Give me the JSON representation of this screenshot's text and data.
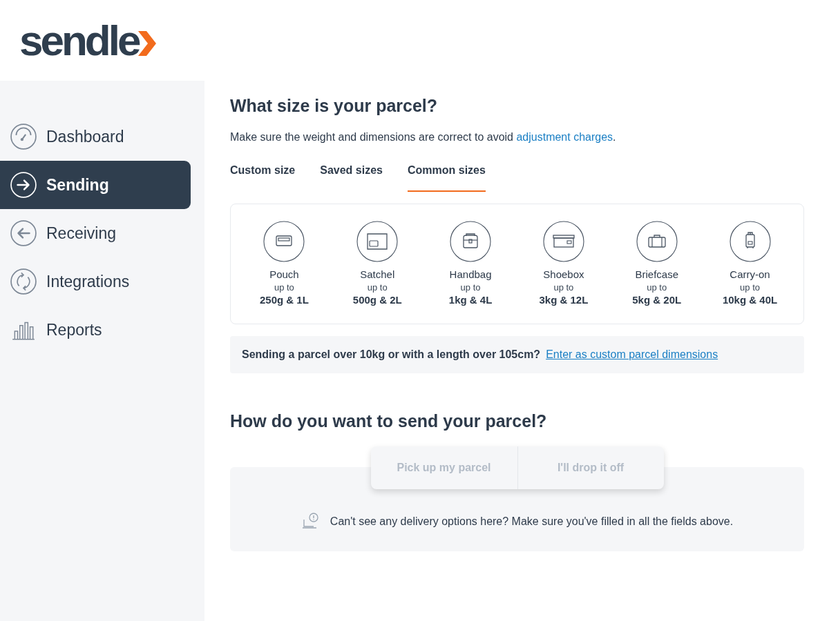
{
  "logo": {
    "text": "sendle"
  },
  "sidebar": {
    "items": [
      {
        "label": "Dashboard",
        "kind": "gauge",
        "selected": false
      },
      {
        "label": "Sending",
        "kind": "send",
        "selected": true
      },
      {
        "label": "Receiving",
        "kind": "receive",
        "selected": false
      },
      {
        "label": "Integrations",
        "kind": "sync",
        "selected": false
      },
      {
        "label": "Reports",
        "kind": "bars",
        "selected": false
      }
    ]
  },
  "size_section": {
    "title": "What size is your parcel?",
    "note": "Make sure the weight and dimensions are correct to avoid ",
    "note_link": "adjustment charges",
    "note_end": ".",
    "tabs": [
      {
        "label": "Custom size",
        "selected": false
      },
      {
        "label": "Saved sizes",
        "selected": false
      },
      {
        "label": "Common sizes",
        "selected": true
      }
    ],
    "sizes": [
      {
        "name": "Pouch",
        "kind": "pouch",
        "prefix": "up to",
        "limit": "250g & 1L"
      },
      {
        "name": "Satchel",
        "kind": "satchel",
        "prefix": "up to",
        "limit": "500g & 2L"
      },
      {
        "name": "Handbag",
        "kind": "handbag",
        "prefix": "up to",
        "limit": "1kg & 4L"
      },
      {
        "name": "Shoebox",
        "kind": "shoebox",
        "prefix": "up to",
        "limit": "3kg & 12L"
      },
      {
        "name": "Briefcase",
        "kind": "briefcase",
        "prefix": "up to",
        "limit": "5kg & 20L"
      },
      {
        "name": "Carry-on",
        "kind": "carryon",
        "prefix": "up to",
        "limit": "10kg & 40L"
      }
    ],
    "oversize": {
      "text": "Sending a parcel over 10kg or with a length over 105cm?",
      "link": "Enter as custom parcel dimensions"
    }
  },
  "send_section": {
    "title": "How do you want to send your parcel?",
    "options": [
      {
        "label": "Pick up my parcel",
        "disabled": true
      },
      {
        "label": "I'll drop it off",
        "disabled": true
      }
    ],
    "hint": "Can't see any delivery options here? Make sure you've filled in all the fields above."
  }
}
